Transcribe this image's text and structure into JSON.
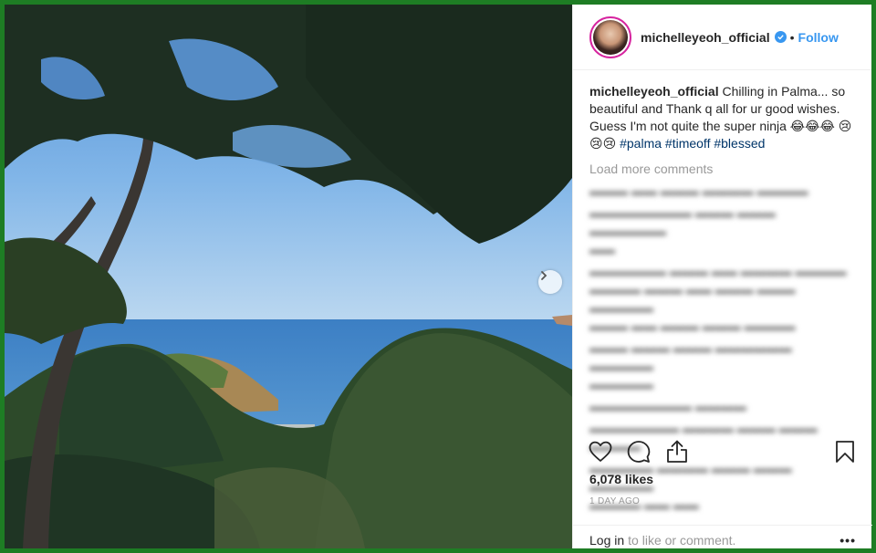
{
  "post": {
    "username": "michelleyeoh_official",
    "follow_label": "Follow",
    "dot": "•",
    "caption_user": "michelleyeoh_official",
    "caption_text": "Chilling in Palma... so beautiful and Thank q all for ur good wishes. Guess I'm not quite the super ninja 😂😂😂 😢😢😢 ",
    "hashtags": [
      "#palma",
      "#timeoff",
      "#blessed"
    ],
    "load_more": "Load more comments",
    "likes": "6,078 likes",
    "time": "1 DAY AGO",
    "login_link": "Log in",
    "login_text": "to like or comment.",
    "more": "•••"
  },
  "colors": {
    "accent": "#3897f0",
    "frame": "#1e7d24",
    "hashtag": "#003569",
    "muted": "#999999"
  },
  "icons": {
    "next": "chevron-right-icon",
    "like": "heart-icon",
    "comment": "comment-icon",
    "share": "share-icon",
    "save": "bookmark-icon",
    "verified": "verified-badge-icon"
  }
}
